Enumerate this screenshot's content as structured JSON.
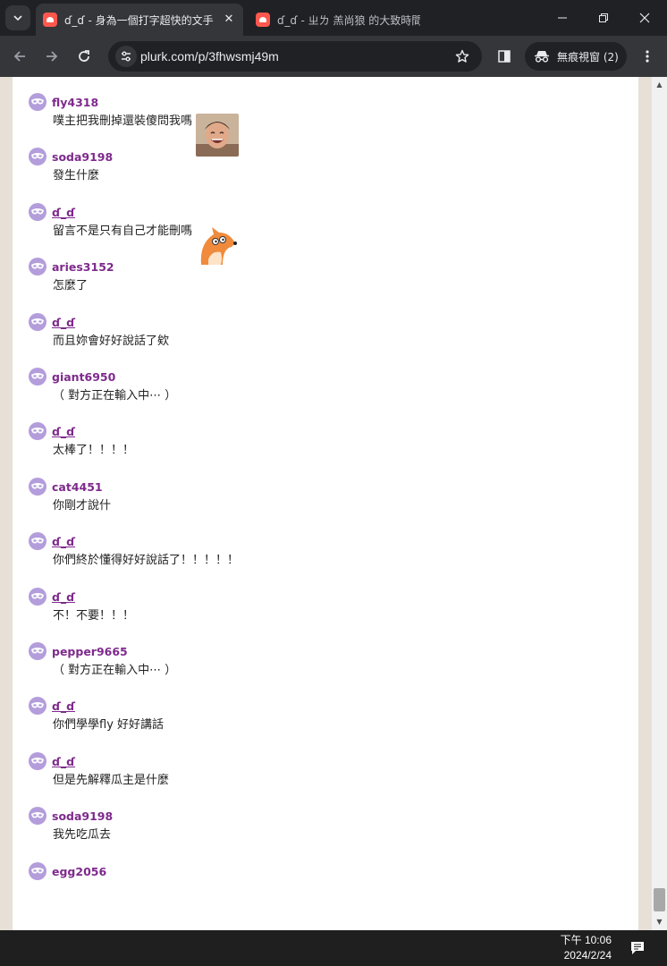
{
  "browser": {
    "tabs": [
      {
        "title": "ɗ_ɗ - 身為一個打字超快的文手",
        "active": true
      },
      {
        "title": "ɗ_ɗ - ㄓㄌ 羔尚狼 的大致時間",
        "active": false
      }
    ],
    "url": "plurk.com/p/3fhwsmj49m",
    "incognito_label": "無痕視窗 (2)"
  },
  "responses": [
    {
      "user": "fly4318",
      "text": "噗主把我刪掉還裝傻問我嗎",
      "emoticon": "laughing-person-emoticon",
      "link": false
    },
    {
      "user": "soda9198",
      "text": "發生什麼",
      "link": false
    },
    {
      "user": "ɗ_ɗ",
      "text": "留言不是只有自己才能刪嗎",
      "emoticon": "fox-emoticon",
      "link": true
    },
    {
      "user": "aries3152",
      "text": "怎麼了",
      "link": false
    },
    {
      "user": "ɗ_ɗ",
      "text": "而且妳會好好說話了欸",
      "link": true
    },
    {
      "user": "giant6950",
      "text": "（ 對方正在輸入中⋯ ）",
      "link": false
    },
    {
      "user": "ɗ_ɗ",
      "text": "太棒了！！！！",
      "link": true
    },
    {
      "user": "cat4451",
      "text": "你剛才說什",
      "link": false
    },
    {
      "user": "ɗ_ɗ",
      "text": "你們終於懂得好好說話了！！！！！",
      "link": true
    },
    {
      "user": "ɗ_ɗ",
      "text": "不！不要！！！",
      "link": true
    },
    {
      "user": "pepper9665",
      "text": "（ 對方正在輸入中⋯ ）",
      "link": false
    },
    {
      "user": "ɗ_ɗ",
      "text": "你們學學fly 好好講話",
      "link": true
    },
    {
      "user": "ɗ_ɗ",
      "text": "但是先解釋瓜主是什麼",
      "link": true
    },
    {
      "user": "soda9198",
      "text": "我先吃瓜去",
      "link": false
    },
    {
      "user": "egg2056",
      "text": "",
      "link": false
    }
  ],
  "taskbar": {
    "time": "下午 10:06",
    "date": "2024/2/24"
  },
  "colors": {
    "username": "#7e2a8c",
    "avatar": "#b39ddb",
    "page_bg": "#e6e0d7"
  }
}
